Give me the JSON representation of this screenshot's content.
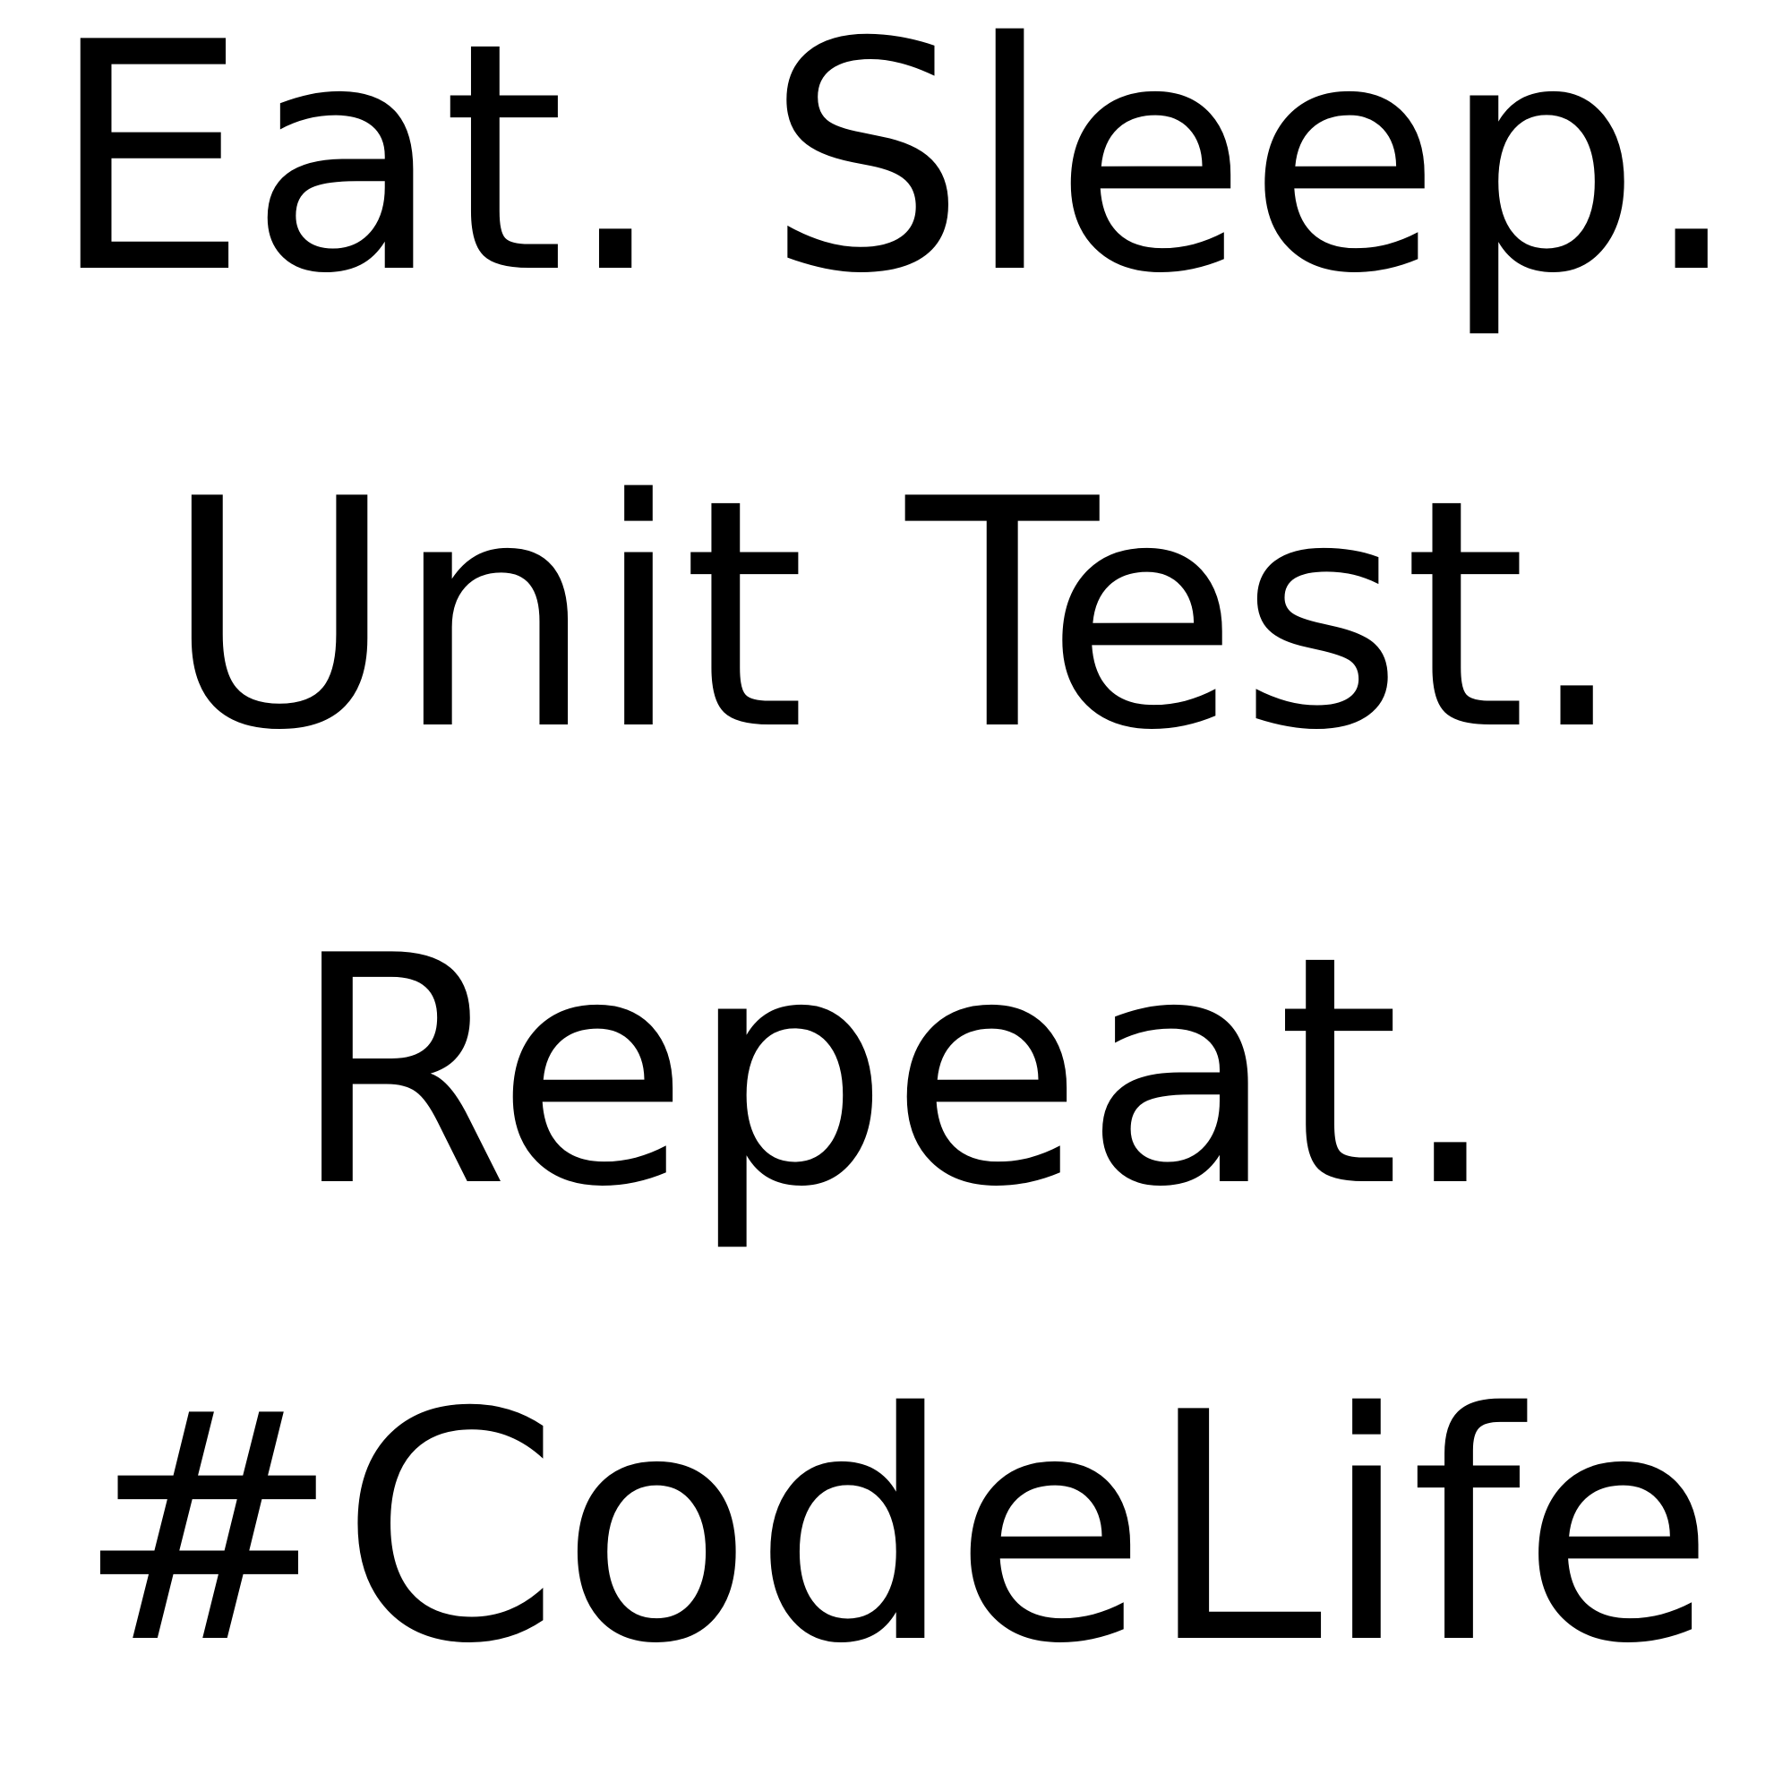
{
  "lines": [
    "Eat. Sleep.",
    "Unit Test.",
    "Repeat.",
    "#CodeLife"
  ],
  "colors": {
    "background": "#ffffff",
    "text": "#000000"
  }
}
